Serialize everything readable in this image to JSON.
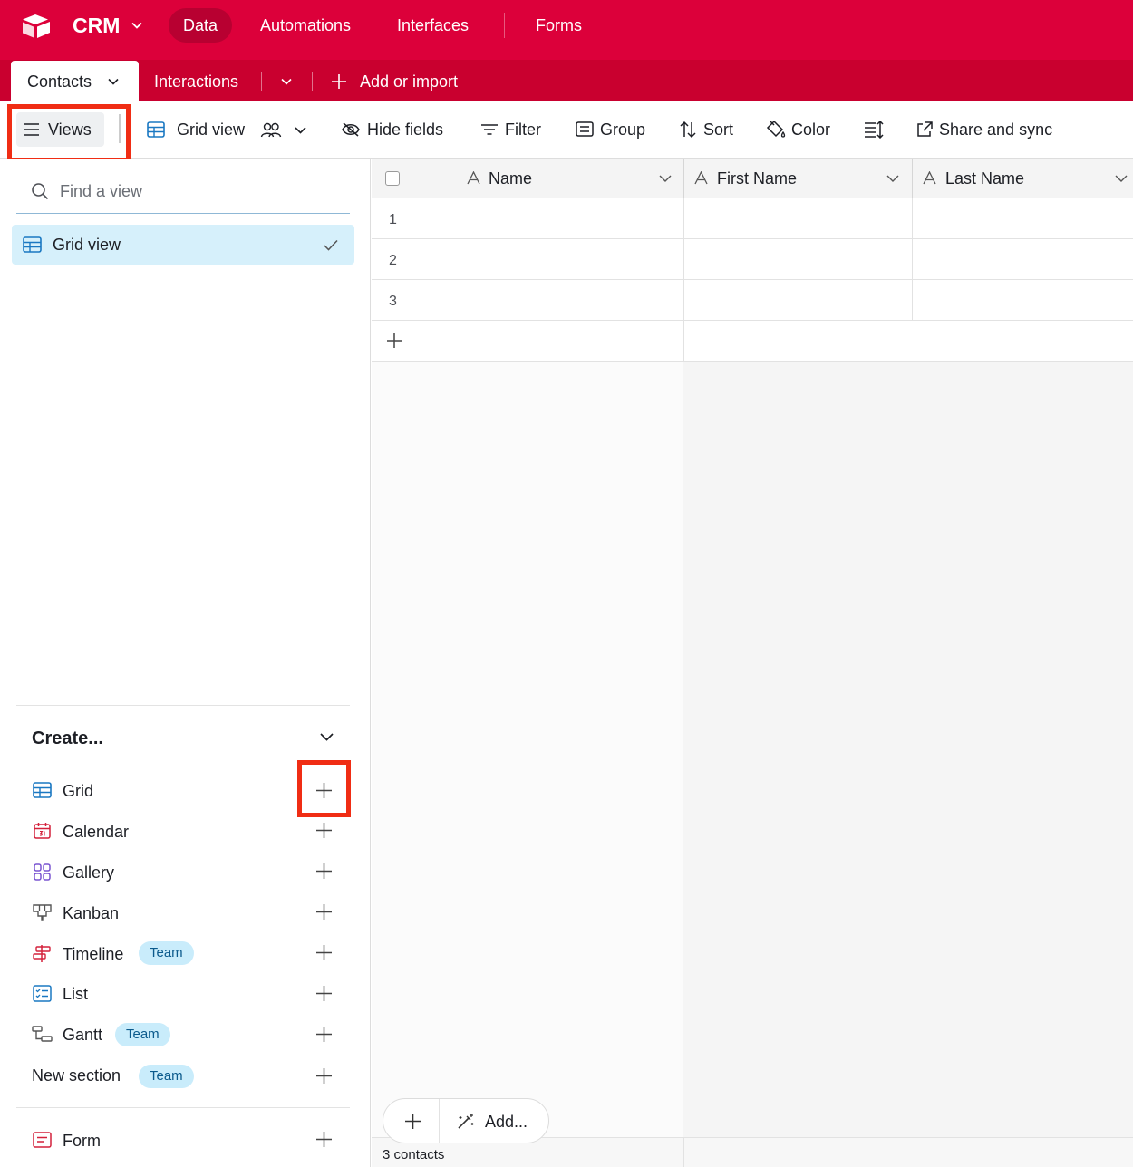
{
  "app": {
    "name": "CRM",
    "nav": [
      "Data",
      "Automations",
      "Interfaces",
      "Forms"
    ],
    "brand_color": "#dc003a"
  },
  "tables": {
    "active": "Contacts",
    "other": "Interactions",
    "add_label": "Add or import"
  },
  "toolbar": {
    "views_label": "Views",
    "view_name": "Grid view",
    "hide_fields": "Hide fields",
    "filter": "Filter",
    "group": "Group",
    "sort": "Sort",
    "color": "Color",
    "share": "Share and sync"
  },
  "sidebar": {
    "search_placeholder": "Find a view",
    "views": [
      {
        "label": "Grid view",
        "selected": true
      }
    ],
    "create_title": "Create...",
    "create_items": [
      {
        "label": "Grid",
        "icon": "grid-icon"
      },
      {
        "label": "Calendar",
        "icon": "calendar-icon"
      },
      {
        "label": "Gallery",
        "icon": "gallery-icon"
      },
      {
        "label": "Kanban",
        "icon": "kanban-icon"
      },
      {
        "label": "Timeline",
        "icon": "timeline-icon",
        "badge": "Team"
      },
      {
        "label": "List",
        "icon": "list-icon"
      },
      {
        "label": "Gantt",
        "icon": "gantt-icon",
        "badge": "Team"
      },
      {
        "label": "New section",
        "badge": "Team"
      },
      {
        "label": "Form",
        "icon": "form-icon"
      }
    ]
  },
  "grid": {
    "columns": [
      "Name",
      "First Name",
      "Last Name"
    ],
    "rows": [
      "1",
      "2",
      "3"
    ],
    "add_label": "Add...",
    "footer": "3 contacts"
  }
}
